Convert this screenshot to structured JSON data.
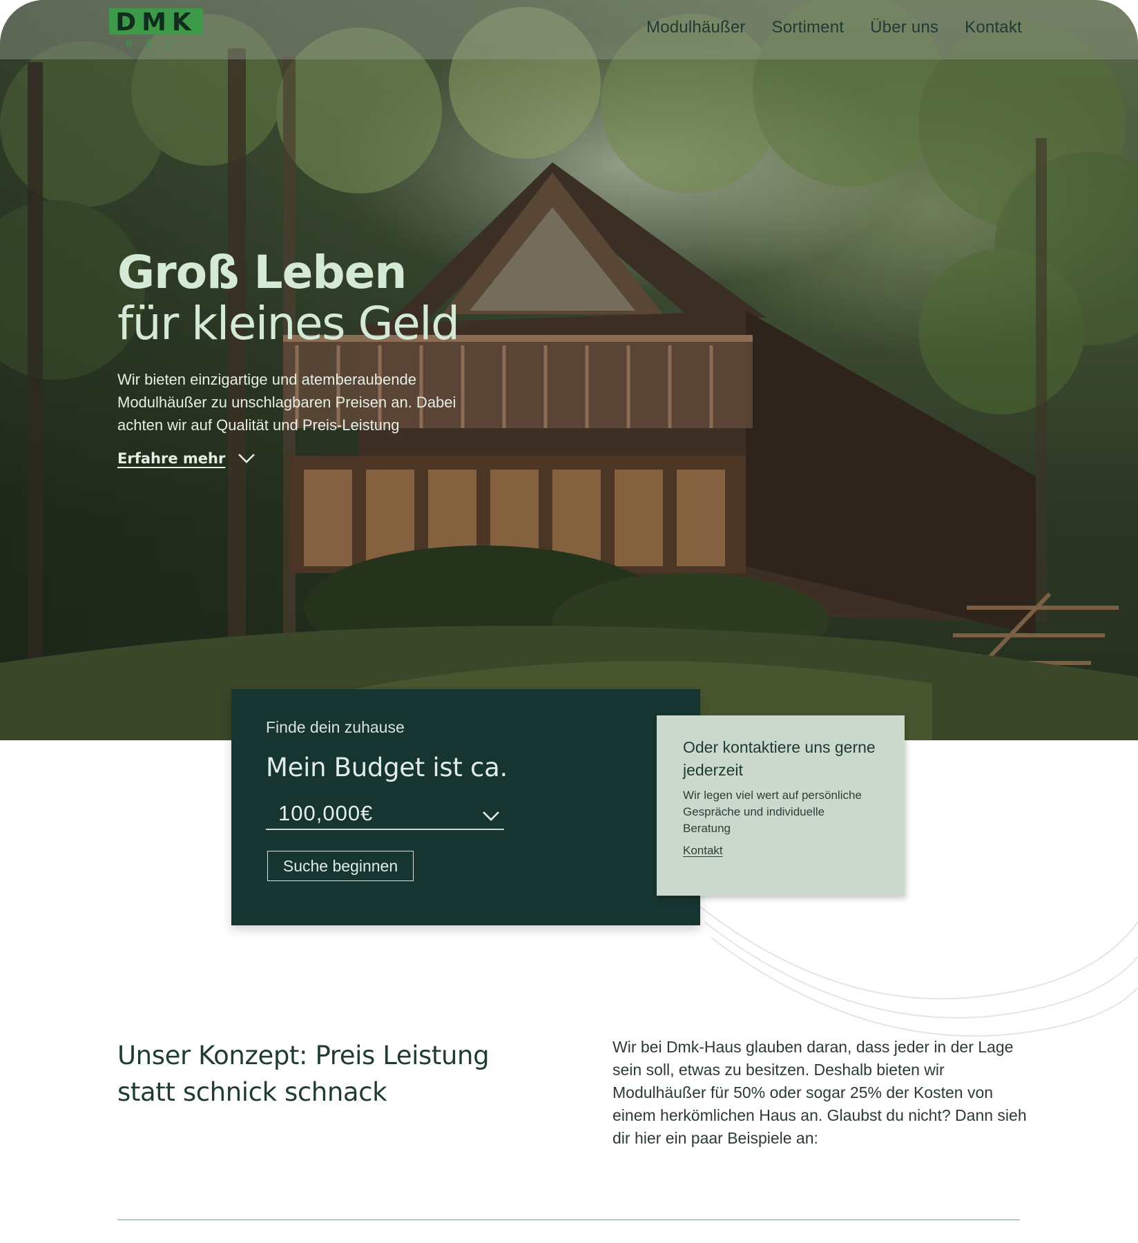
{
  "brand": {
    "logo_text": "DMK",
    "logo_subtext": "BAU",
    "logo_color": "#3c9a48"
  },
  "nav": {
    "items": [
      "Modulhäußer",
      "Sortiment",
      "Über uns",
      "Kontakt"
    ]
  },
  "hero": {
    "title_line1": "Groß Leben",
    "title_line2": "für kleines Geld",
    "subtitle": "Wir bieten einzigartige und atemberaubende Modulhäußer zu unschlagbaren Preisen an. Dabei achten wir auf Qualität und Preis-Leistung",
    "more_label": "Erfahre mehr",
    "more_icon": "chevron-down-icon"
  },
  "budget": {
    "kicker": "Finde dein zuhause",
    "title": "Mein Budget ist ca.",
    "selected_value": "100,000€",
    "search_label": "Suche beginnen",
    "card_color": "#173530"
  },
  "contact": {
    "title": "Oder kontaktiere uns gerne jederzeit",
    "text": "Wir legen viel wert auf persönliche Gespräche und individuelle Beratung",
    "link_label": "Kontakt",
    "card_color": "#cbd9cc"
  },
  "concept": {
    "title": "Unser Konzept: Preis Leistung statt schnick schnack",
    "text": "Wir bei Dmk-Haus glauben daran, dass jeder in der Lage sein soll, etwas zu besitzen. Deshalb bieten wir Modulhäußer für 50% oder sogar 25% der Kosten von einem  herkömlichen Haus an. Glaubst du nicht? Dann sieh dir hier ein paar Beispiele an:"
  }
}
